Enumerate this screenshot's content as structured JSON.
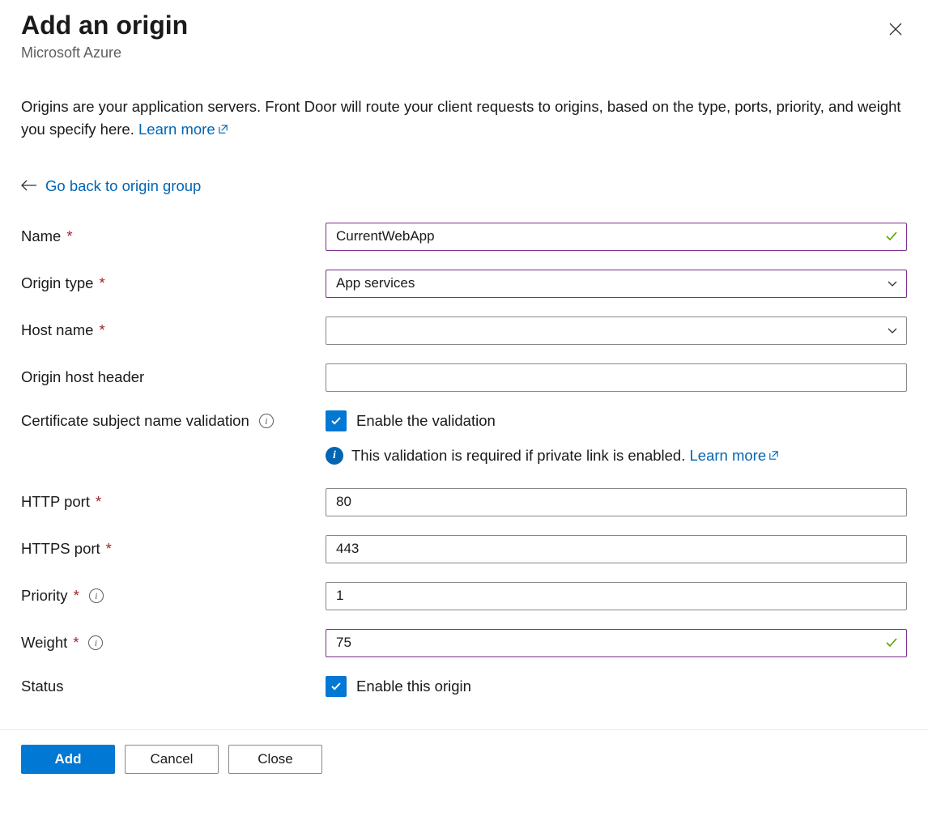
{
  "header": {
    "title": "Add an origin",
    "subtitle": "Microsoft Azure"
  },
  "description": {
    "text": "Origins are your application servers. Front Door will route your client requests to origins, based on the type, ports, priority, and weight you specify here. ",
    "learn_more": "Learn more"
  },
  "back_link": "Go back to origin group",
  "fields": {
    "name": {
      "label": "Name",
      "value": "CurrentWebApp"
    },
    "origin_type": {
      "label": "Origin type",
      "value": "App services"
    },
    "host_name": {
      "label": "Host name",
      "value": ""
    },
    "origin_host_header": {
      "label": "Origin host header",
      "value": ""
    },
    "cert_validation": {
      "label": "Certificate subject name validation",
      "checkbox_label": "Enable the validation",
      "info_text": "This validation is required if private link is enabled. ",
      "info_link": "Learn more"
    },
    "http_port": {
      "label": "HTTP port",
      "value": "80"
    },
    "https_port": {
      "label": "HTTPS port",
      "value": "443"
    },
    "priority": {
      "label": "Priority",
      "value": "1"
    },
    "weight": {
      "label": "Weight",
      "value": "75"
    },
    "status": {
      "label": "Status",
      "checkbox_label": "Enable this origin"
    }
  },
  "buttons": {
    "add": "Add",
    "cancel": "Cancel",
    "close": "Close"
  }
}
